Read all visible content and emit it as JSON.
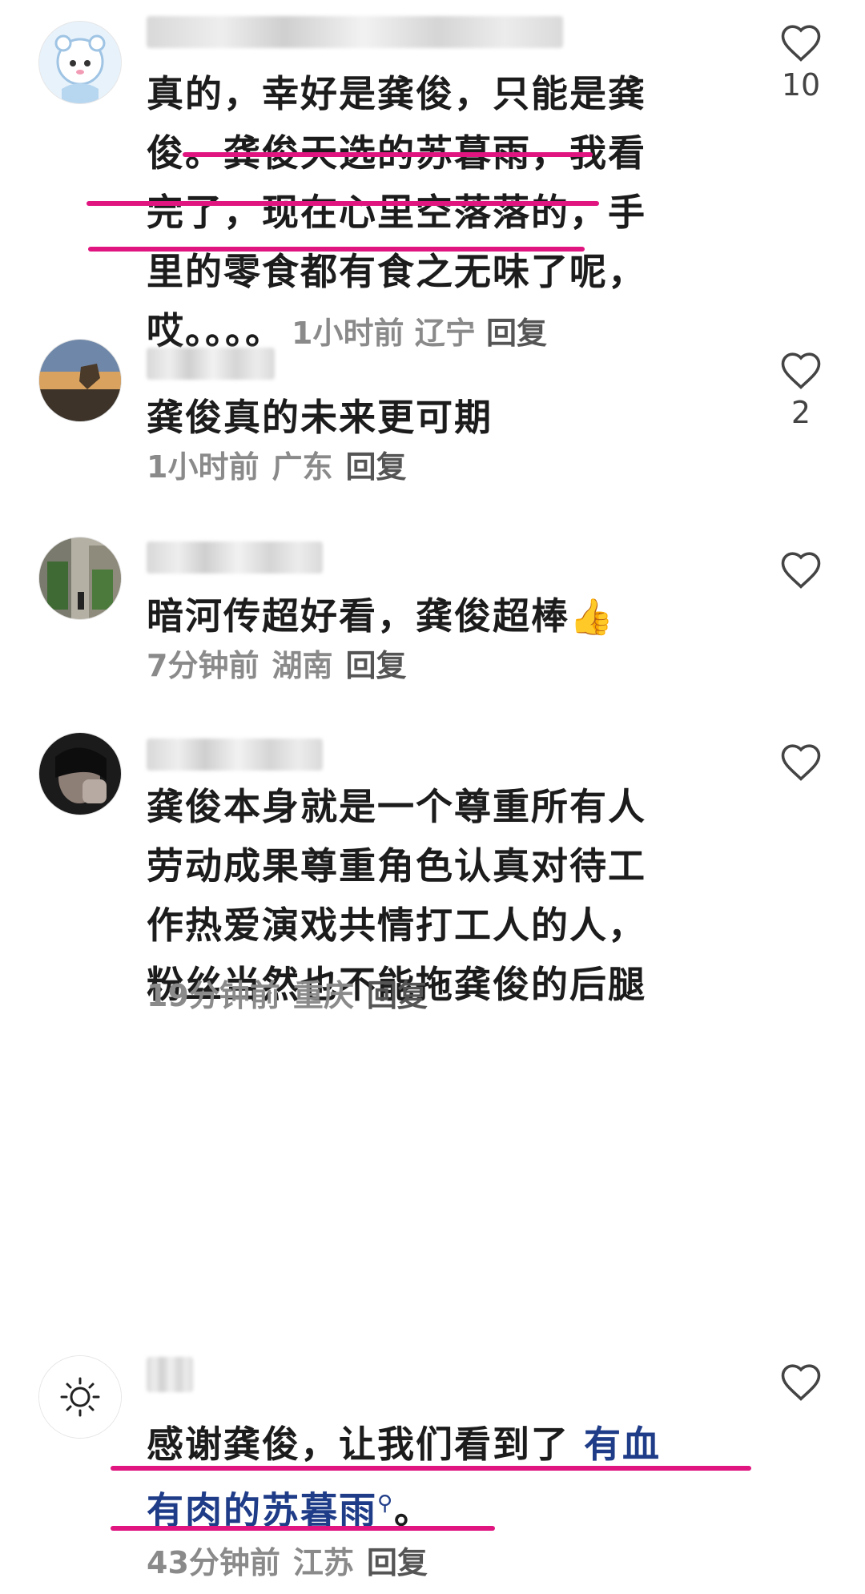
{
  "comments": [
    {
      "text_lines": [
        "真的，幸好是龚俊，只能是龚",
        "俊。龚俊天选的苏暮雨，我看",
        "完了，现在心里空落落的，手",
        "里的零食都有食之无味了呢，",
        "哎。。。。"
      ],
      "time": "1小时前",
      "location": "辽宁",
      "reply": "回复",
      "likes": "10"
    },
    {
      "text": "龚俊真的未来更可期",
      "time": "1小时前",
      "location": "广东",
      "reply": "回复",
      "likes": "2"
    },
    {
      "text": "暗河传超好看，龚俊超棒",
      "emoji": "👍",
      "time": "7分钟前",
      "location": "湖南",
      "reply": "回复"
    },
    {
      "text_lines": [
        "龚俊本身就是一个尊重所有人",
        "劳动成果尊重角色认真对待工",
        "作热爱演戏共情打工人的人，",
        "粉丝当然也不能拖龚俊的后腿"
      ],
      "time": "19分钟前",
      "location": "重庆",
      "reply": "回复"
    },
    {
      "text_lines_prefix": "感谢龚俊，让我们看到了",
      "link_part1": "有血",
      "link_part2": "有肉的苏暮雨",
      "text_suffix": "。",
      "time": "43分钟前",
      "location": "江苏",
      "reply": "回复"
    }
  ],
  "colors": {
    "highlight_underline": "#e0157f",
    "link": "#1f3c88",
    "meta": "#8a8a8a"
  },
  "icons": {
    "like": "heart-outline-icon",
    "search_mark": "search-icon"
  }
}
